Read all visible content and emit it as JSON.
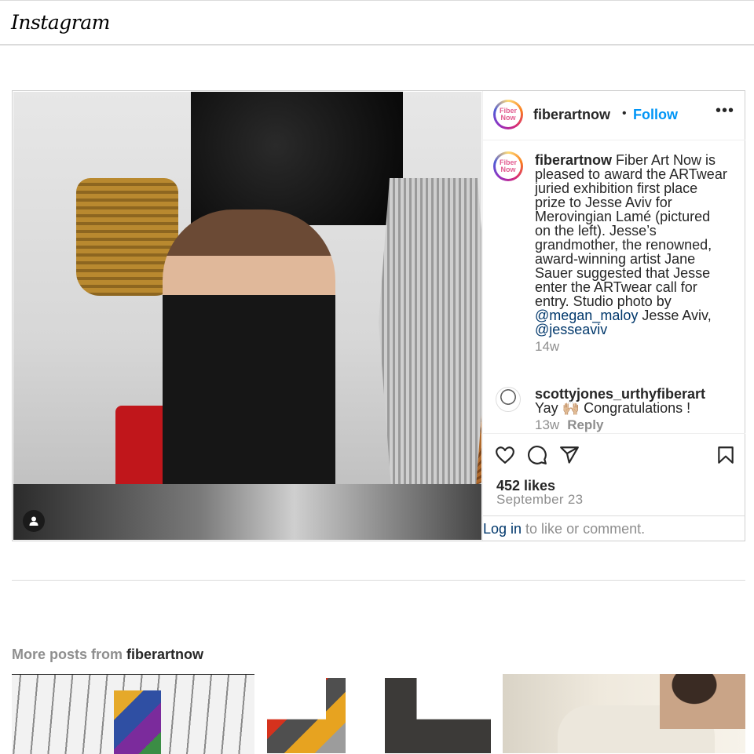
{
  "app": {
    "logo": "Instagram"
  },
  "post": {
    "account": "fiberartnow",
    "avatar_text": "Fiber Now",
    "follow_label": "Follow",
    "more_label": "•••",
    "caption_user": "fiberartnow",
    "caption_text_1": " Fiber Art Now is pleased to award the ARTwear juried exhibition first place prize to Jesse Aviv for Merovingian Lamé (pictured on the left). Jesse’s grandmother, the renowned, award-winning artist Jane Sauer suggested that Jesse enter the ARTwear call for entry. Studio photo by ",
    "mention_1": "@megan_maloy",
    "caption_text_2": " Jesse Aviv, ",
    "mention_2": "@jesseaviv",
    "caption_time": "14w",
    "comment": {
      "user": "scottyjones_urthyfiberart",
      "text": "Yay 🙌🏼 Congratulations !",
      "time": "13w",
      "reply_label": "Reply"
    },
    "likes": "452 likes",
    "date": "September 23",
    "login_link": "Log in",
    "login_text": " to like or comment."
  },
  "more": {
    "prefix": "More posts from ",
    "user": "fiberartnow"
  },
  "icons": {
    "like": "heart-icon",
    "comment": "comment-icon",
    "share": "share-icon",
    "save": "bookmark-icon",
    "user_tag": "user-icon"
  },
  "colors": {
    "link_blue": "#0095f6",
    "mention_blue": "#00376b",
    "muted": "#8e8e8e",
    "text": "#262626"
  }
}
